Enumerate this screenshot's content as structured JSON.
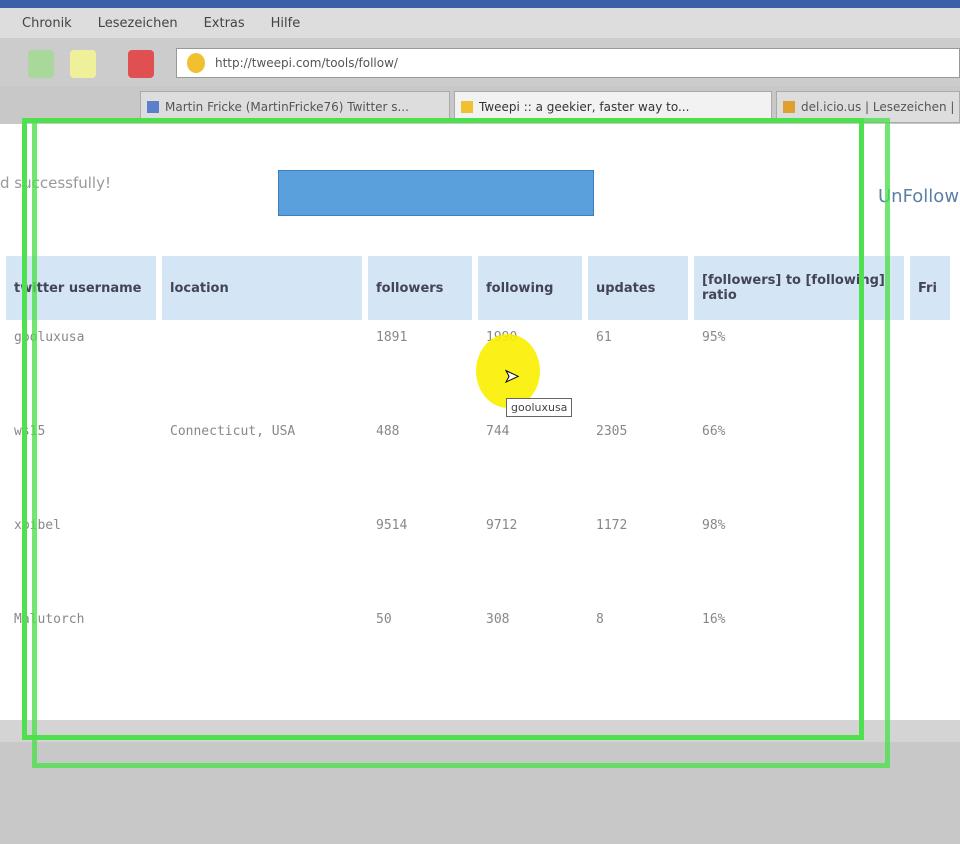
{
  "menu": [
    "Chronik",
    "Lesezeichen",
    "Extras",
    "Hilfe"
  ],
  "url": "http://tweepi.com/tools/follow/",
  "tabs": [
    "Martin Fricke (MartinFricke76) Twitter s...",
    "Tweepi :: a geekier, faster way to...",
    "del.icio.us | Lesezeichen | De..."
  ],
  "message": "d successfully!",
  "unfollow_label": "UnFollow",
  "headers": [
    "twitter username",
    "location",
    "followers",
    "following",
    "updates",
    "[followers] to [following] ratio",
    "Fri"
  ],
  "rows": [
    {
      "user": "gooluxusa",
      "location": "",
      "followers": "1891",
      "following": "1990",
      "updates": "61",
      "ratio": "95%"
    },
    {
      "user": "ws15",
      "location": "Connecticut, USA",
      "followers": "488",
      "following": "744",
      "updates": "2305",
      "ratio": "66%"
    },
    {
      "user": "xbibel",
      "location": "",
      "followers": "9514",
      "following": "9712",
      "updates": "1172",
      "ratio": "98%"
    },
    {
      "user": "Malutorch",
      "location": "",
      "followers": "50",
      "following": "308",
      "updates": "8",
      "ratio": "16%"
    }
  ],
  "tooltip": "gooluxusa",
  "colors": {
    "highlight": "#4ee04e",
    "header": "#d4e6f6",
    "cursor_glow": "#faf000"
  }
}
